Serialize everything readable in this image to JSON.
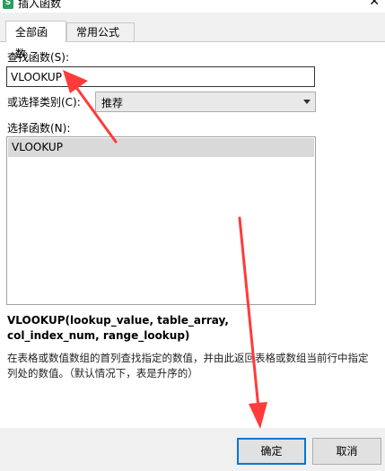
{
  "window": {
    "title": "插入函数",
    "app_icon_glyph": "S"
  },
  "tabs": [
    {
      "label": "全部函数",
      "active": true
    },
    {
      "label": "常用公式",
      "active": false
    }
  ],
  "search": {
    "label": "查找函数(S):",
    "value": "VLOOKUP"
  },
  "category": {
    "label": "或选择类别(C):",
    "selected": "推荐"
  },
  "function_list": {
    "label": "选择函数(N):",
    "items": [
      "VLOOKUP"
    ]
  },
  "signature": "VLOOKUP(lookup_value, table_array, col_index_num, range_lookup)",
  "description": "在表格或数值数组的首列查找指定的数值，并由此返回表格或数组当前行中指定列处的数值。（默认情况下，表是升序的）",
  "buttons": {
    "ok": "确定",
    "cancel": "取消"
  },
  "colors": {
    "accent_border": "#0078d7",
    "annotation_arrow": "#ff3b3b"
  }
}
